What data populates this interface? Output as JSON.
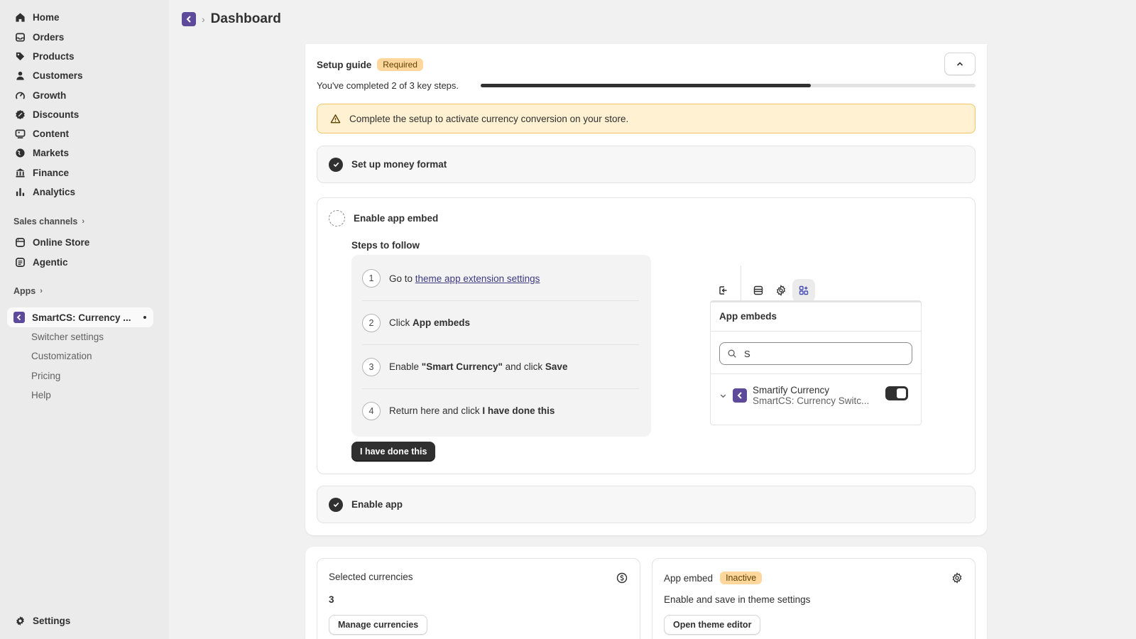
{
  "sidebar": {
    "nav": [
      {
        "label": "Home",
        "icon": "home-icon"
      },
      {
        "label": "Orders",
        "icon": "orders-icon"
      },
      {
        "label": "Products",
        "icon": "tag-icon"
      },
      {
        "label": "Customers",
        "icon": "person-icon"
      },
      {
        "label": "Growth",
        "icon": "growth-icon"
      },
      {
        "label": "Discounts",
        "icon": "discount-icon"
      },
      {
        "label": "Content",
        "icon": "content-icon"
      },
      {
        "label": "Markets",
        "icon": "globe-icon"
      },
      {
        "label": "Finance",
        "icon": "bank-icon"
      },
      {
        "label": "Analytics",
        "icon": "bar-chart-icon"
      }
    ],
    "sales_channels_label": "Sales channels",
    "channels": [
      {
        "label": "Online Store",
        "icon": "store-icon"
      },
      {
        "label": "Agentic",
        "icon": "agentic-icon"
      }
    ],
    "apps_label": "Apps",
    "app": {
      "label": "SmartCS: Currency ..."
    },
    "app_subitems": [
      "Switcher settings",
      "Customization",
      "Pricing",
      "Help"
    ],
    "settings_label": "Settings"
  },
  "header": {
    "title": "Dashboard"
  },
  "guide": {
    "title": "Setup guide",
    "badge": "Required",
    "progress_text": "You've completed 2 of 3 key steps.",
    "progress_fraction": 0.667,
    "warning": "Complete the setup to activate currency conversion on your store.",
    "step_money": "Set up money format",
    "step_embed": "Enable app embed",
    "steps_to_follow": "Steps to follow",
    "steps": [
      {
        "num": "1",
        "prefix": "Go to ",
        "link": "theme app extension settings"
      },
      {
        "num": "2",
        "prefix": "Click ",
        "bold": "App embeds"
      },
      {
        "num": "3",
        "prefix": "Enable ",
        "bold": "\"Smart Currency\"",
        "mid": " and click ",
        "bold2": "Save"
      },
      {
        "num": "4",
        "prefix": "Return here and click ",
        "bold": "I have done this"
      }
    ],
    "done_button": "I have done this",
    "step_enable": "Enable app"
  },
  "preview": {
    "title": "App embeds",
    "search_value": "S",
    "item_name": "Smartify Currency",
    "item_sub": "SmartCS: Currency Switc..."
  },
  "currencies_card": {
    "title": "Selected currencies",
    "value": "3",
    "button": "Manage currencies"
  },
  "embed_card": {
    "title": "App embed",
    "badge": "Inactive",
    "desc": "Enable and save in theme settings",
    "button": "Open theme editor"
  },
  "colors": {
    "brand": "#5e4a9a",
    "warning_bg": "#fff1d1",
    "badge_bg": "#ffd79d"
  }
}
